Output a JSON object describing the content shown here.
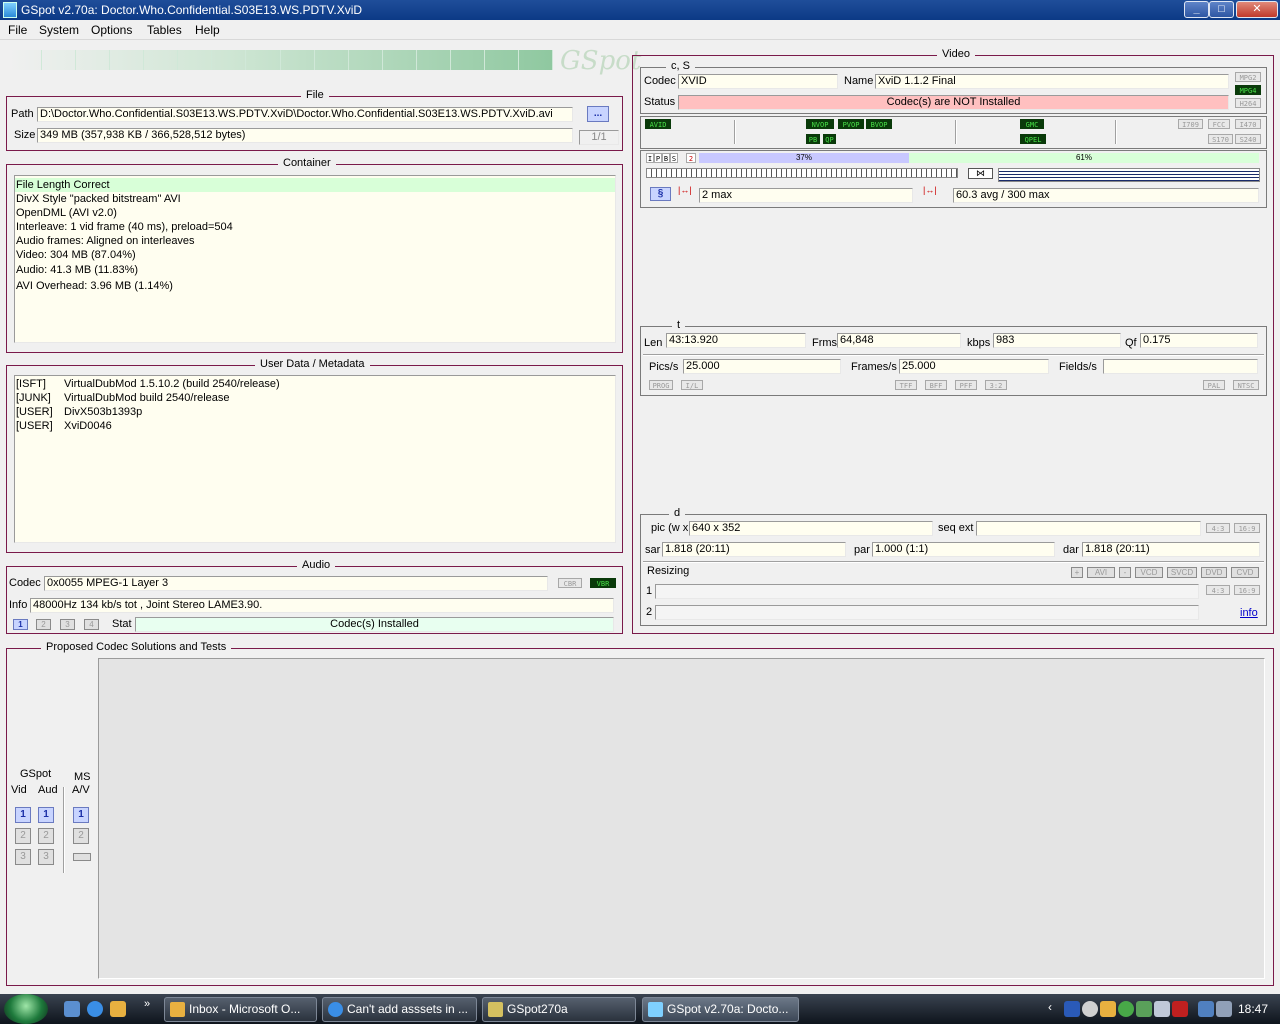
{
  "window": {
    "title": "GSpot v2.70a: Doctor.Who.Confidential.S03E13.WS.PDTV.XviD"
  },
  "menu": [
    "File",
    "System",
    "Options",
    "Tables",
    "Help"
  ],
  "logo_text": "GSpot",
  "file": {
    "title": "File",
    "path_label": "Path",
    "path_value": "D:\\Doctor.Who.Confidential.S03E13.WS.PDTV.XviD\\Doctor.Who.Confidential.S03E13.WS.PDTV.XviD.avi",
    "browse_label": "...",
    "size_label": "Size",
    "size_value": "349 MB (357,938 KB / 366,528,512 bytes)",
    "page_count": "1/1"
  },
  "container": {
    "title": "Container",
    "lines": [
      "File Length Correct",
      "DivX Style \"packed bitstream\" AVI",
      "OpenDML (AVI v2.0)",
      "Interleave: 1 vid frame (40 ms), preload=504",
      "Audio frames: Aligned on interleaves",
      "Video: 304 MB (87.04%)",
      "Audio: 41.3 MB (11.83%)",
      "AVI Overhead: 3.96 MB (1.14%)"
    ]
  },
  "metadata": {
    "title": "User Data / Metadata",
    "rows": [
      {
        "tag": "[ISFT]",
        "value": "VirtualDubMod 1.5.10.2 (build 2540/release)"
      },
      {
        "tag": "[JUNK]",
        "value": "VirtualDubMod build 2540/release"
      },
      {
        "tag": "[USER]",
        "value": "DivX503b1393p"
      },
      {
        "tag": "[USER]",
        "value": "XviD0046"
      }
    ]
  },
  "audio": {
    "title": "Audio",
    "codec_label": "Codec",
    "codec_value": "0x0055 MPEG-1 Layer 3",
    "badges": [
      "CBR",
      "VBR"
    ],
    "info_label": "Info",
    "info_value": "48000Hz  134 kb/s tot , Joint Stereo LAME3.90.",
    "streams": [
      "1",
      "2",
      "3",
      "4"
    ],
    "stat_label": "Stat",
    "stat_value": "Codec(s) Installed"
  },
  "video": {
    "title": "Video",
    "cs_label": "c, S",
    "codec_label": "Codec",
    "codec_value": "XVID",
    "name_label": "Name",
    "name_value": "XviD 1.1.2 Final",
    "status_label": "Status",
    "status_value": "Codec(s) are NOT Installed",
    "fmt_badges": [
      "MPG2",
      "MPG4",
      "H264"
    ],
    "flag_badges": [
      "AVID",
      "NVOP",
      "PVOP",
      "BVOP",
      "PB",
      "QP",
      "GMC",
      "QPEL",
      "I709",
      "FCC",
      "I470",
      "S170",
      "S240"
    ],
    "frame_types": [
      "I",
      "P",
      "B",
      "S"
    ],
    "bar_label": "2",
    "bar_pct_a": "37%",
    "bar_pct_b": "61%",
    "bframes_value": "2 max",
    "bitrate_value": "60.3 avg / 300 max",
    "t_label": "t",
    "len_label": "Len",
    "len_value": "43:13.920",
    "frms_label": "Frms",
    "frms_value": "64,848",
    "kbps_label": "kbps",
    "kbps_value": "983",
    "qf_label": "Qf",
    "qf_value": "0.175",
    "pics_label": "Pics/s",
    "pics_value": "25.000",
    "frames_label": "Frames/s",
    "frames_value": "25.000",
    "fields_label": "Fields/s",
    "fields_value": "",
    "scan_badges": [
      "PROG",
      "I/L",
      "TFF",
      "BFF",
      "PFF",
      "3:2",
      "PAL",
      "NTSC"
    ],
    "d_label": "d",
    "pic_label": "pic (w x",
    "pic_value": "640 x 352",
    "seqext_label": "seq ext",
    "seqext_value": "",
    "aspect_badges": [
      "4:3",
      "16:9"
    ],
    "sar_label": "sar",
    "sar_value": "1.818 (20:11)",
    "par_label": "par",
    "par_value": "1.000 (1:1)",
    "dar_label": "dar",
    "dar_value": "1.818 (20:11)",
    "resizing_label": "Resizing",
    "resize_buttons": [
      "+",
      "AVI",
      "-",
      "VCD",
      "SVCD",
      "DVD",
      "CVD"
    ],
    "resize_aspect": [
      "4:3",
      "16:9"
    ],
    "resize_row1": "1",
    "resize_row2": "2",
    "info_link": "info"
  },
  "proposed": {
    "title": "Proposed Codec Solutions and Tests",
    "gspot_label": "GSpot",
    "vid_label": "Vid",
    "aud_label": "Aud",
    "ms_label": "MS",
    "av_label": "A/V",
    "buttons": [
      "1",
      "2",
      "3"
    ]
  },
  "taskbar": {
    "tasks": [
      {
        "label": "Inbox - Microsoft O..."
      },
      {
        "label": "Can't add asssets in ..."
      },
      {
        "label": "GSpot270a"
      },
      {
        "label": "GSpot v2.70a: Docto..."
      }
    ],
    "clock": "18:47"
  },
  "colors": {
    "border": "#7a1a4a",
    "field_bg": "#fffef0",
    "status_bad": "#ffc0c0",
    "status_ok": "#e8fff0",
    "badge_on": "#0a3a0a"
  }
}
